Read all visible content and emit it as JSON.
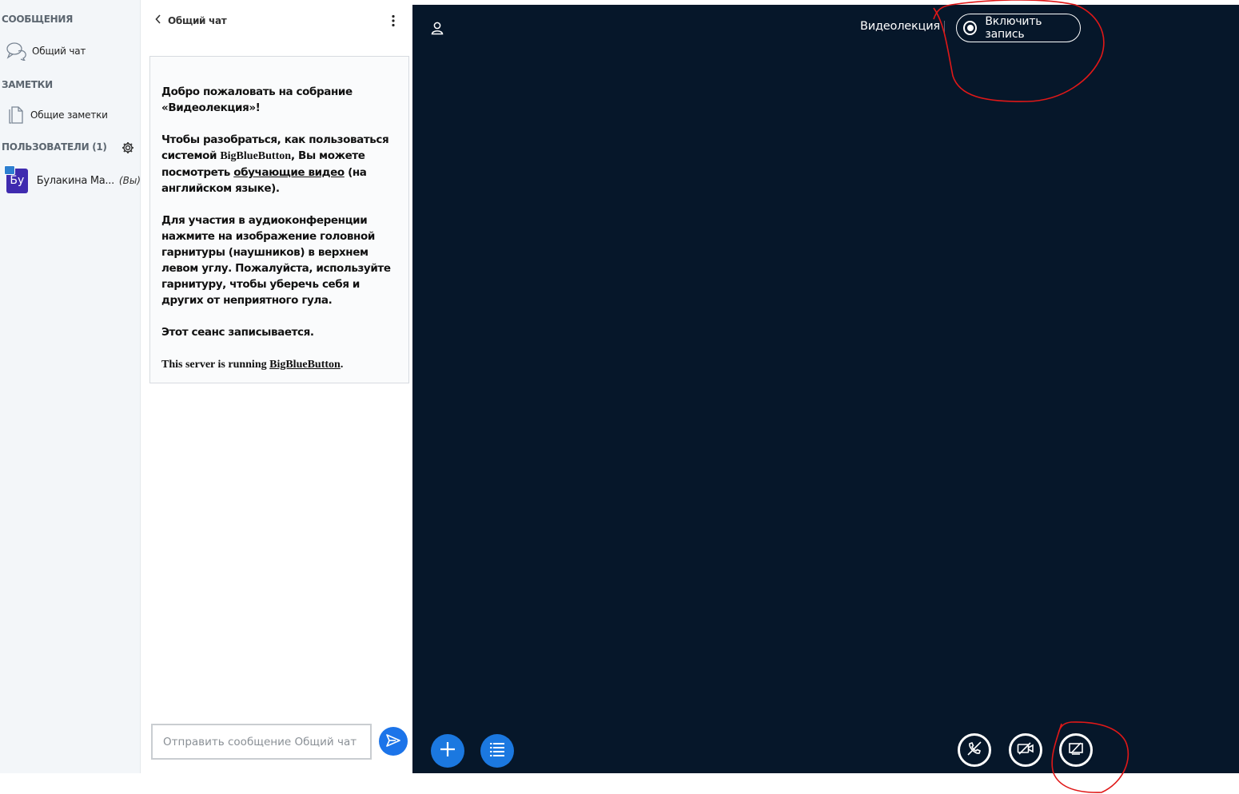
{
  "sidebar": {
    "messages_header": "СООБЩЕНИЯ",
    "public_chat_label": "Общий чат",
    "notes_header": "ЗАМЕТКИ",
    "shared_notes_label": "Общие заметки",
    "users_header": "ПОЛЬЗОВАТЕЛИ (1)",
    "users": [
      {
        "initials": "Бу",
        "name": "Булакина Ма...",
        "suffix": "(Вы)"
      }
    ]
  },
  "chat": {
    "title": "Общий чат",
    "welcome": {
      "p1_a": "Добро пожаловать на собрание «",
      "p1_b": "Видеолекция",
      "p1_c": "»!",
      "p2_a": "Чтобы разобраться, как пользоваться системой ",
      "p2_b": "BigBlueButton",
      "p2_c": ", Вы можете посмотреть ",
      "p2_link": "обучающие видео",
      "p2_d": " (на английском языке).",
      "p3_a": "Для участия в аудиоконференции нажмите на изображение головной гарнитуры (наушников) в верхнем левом углу. ",
      "p3_b": "Пожалуйста, используйте гарнитуру, чтобы уберечь себя и других от неприятного гула.",
      "p4": "Этот сеанс записывается.",
      "p5_a": "This server is running ",
      "p5_link": "BigBlueButton",
      "p5_b": "."
    },
    "input_placeholder": "Отправить сообщение Общий чат"
  },
  "main": {
    "meeting_name": "Видеолекция",
    "record_label": "Включить запись"
  },
  "icons": {
    "public_chat": "chat-bubbles-icon",
    "shared_notes": "document-icon",
    "settings": "gear-icon",
    "back": "chevron-left-icon",
    "menu": "kebab-menu-icon",
    "send": "send-icon",
    "user": "user-icon",
    "actions": "plus-icon",
    "polls": "list-icon",
    "audio": "audio-off-icon",
    "video": "video-off-icon",
    "screenshare": "screenshare-icon"
  },
  "colors": {
    "main_background": "#06172a",
    "accent_blue": "#1b78e0",
    "avatar": "#3f2baf",
    "annotation_red": "#e01818"
  }
}
